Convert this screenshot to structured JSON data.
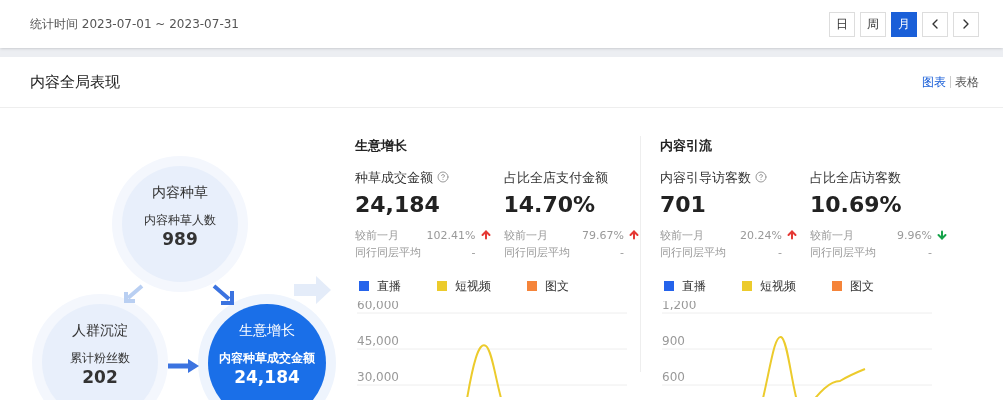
{
  "filter_bar": {
    "label": "统计时间 2023-07-01 ~ 2023-07-31",
    "periods": [
      {
        "label": "日",
        "selected": false
      },
      {
        "label": "周",
        "selected": false
      },
      {
        "label": "月",
        "selected": true
      }
    ]
  },
  "card": {
    "title": "内容全局表现",
    "view_toggle": [
      {
        "label": "图表",
        "selected": true
      },
      {
        "label": "表格",
        "selected": false
      }
    ]
  },
  "flow": [
    {
      "kind": "light",
      "title": "内容种草",
      "metric": "内容种草人数",
      "value": "989"
    },
    {
      "kind": "light",
      "title": "人群沉淀",
      "metric": "累计粉丝数",
      "value": "202"
    },
    {
      "kind": "primary",
      "title": "生意增长",
      "metric": "内容种草成交金额",
      "value": "24,184"
    }
  ],
  "sections": [
    {
      "title": "生意增长",
      "metrics": [
        {
          "label": "种草成交金额",
          "help": true,
          "value": "24,184",
          "compare": [
            {
              "label": "较前一月",
              "value": "102.41%",
              "rising": true
            },
            {
              "label": "同行同层平均",
              "value": "-"
            }
          ]
        },
        {
          "label": "占比全店支付金额",
          "help": false,
          "value": "14.70%",
          "compare": [
            {
              "label": "较前一月",
              "value": "79.67%",
              "rising": true
            },
            {
              "label": "同行同层平均",
              "value": "-"
            }
          ]
        }
      ],
      "legend": [
        {
          "label": "直播",
          "color": "#2563eb"
        },
        {
          "label": "短视频",
          "color": "#eccb2c"
        },
        {
          "label": "图文",
          "color": "#f5843a"
        }
      ],
      "yticks": [
        "60,000",
        "45,000",
        "30,000"
      ]
    },
    {
      "title": "内容引流",
      "metrics": [
        {
          "label": "内容引导访客数",
          "help": true,
          "value": "701",
          "compare": [
            {
              "label": "较前一月",
              "value": "20.24%",
              "rising": true
            },
            {
              "label": "同行同层平均",
              "value": "-"
            }
          ]
        },
        {
          "label": "占比全店访客数",
          "help": false,
          "value": "10.69%",
          "compare": [
            {
              "label": "较前一月",
              "value": "9.96%",
              "rising": false
            },
            {
              "label": "同行同层平均",
              "value": "-"
            }
          ]
        }
      ],
      "legend": [
        {
          "label": "直播",
          "color": "#2563eb"
        },
        {
          "label": "短视频",
          "color": "#eccb2c"
        },
        {
          "label": "图文",
          "color": "#f5843a"
        }
      ],
      "yticks": [
        "1,200",
        "900",
        "600"
      ]
    }
  ]
}
